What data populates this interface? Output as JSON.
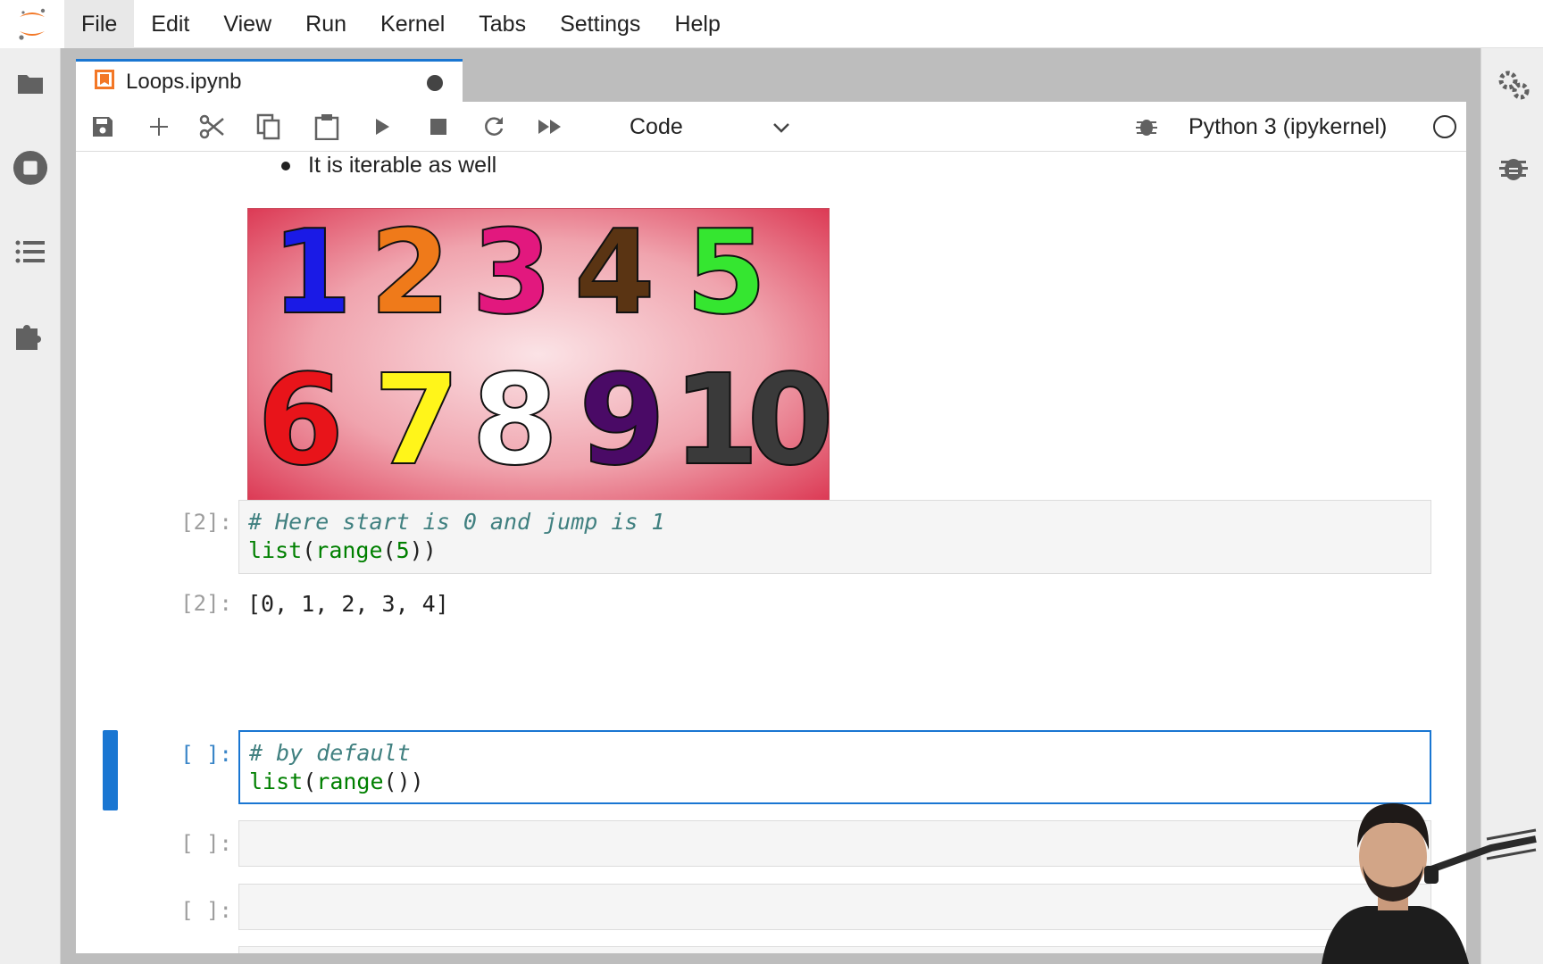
{
  "menubar": {
    "items": [
      "File",
      "Edit",
      "View",
      "Run",
      "Kernel",
      "Tabs",
      "Settings",
      "Help"
    ]
  },
  "tab": {
    "title": "Loops.ipynb"
  },
  "toolbar": {
    "cell_type": "Code",
    "kernel_name": "Python 3 (ipykernel)"
  },
  "notebook": {
    "markdown_bullet": "It is iterable as well",
    "image_digits": [
      "1",
      "2",
      "3",
      "4",
      "5",
      "6",
      "7",
      "8",
      "9",
      "10"
    ],
    "cells": [
      {
        "prompt": "[2]:",
        "code_comment": "# Here start is 0 and jump is 1",
        "code_builtin1": "list",
        "code_paren1": "(",
        "code_builtin2": "range",
        "code_paren2": "(",
        "code_num": "5",
        "code_close": "))",
        "output_prompt": "[2]:",
        "output": "[0, 1, 2, 3, 4]"
      },
      {
        "prompt": "[ ]:",
        "code_comment": "# by default",
        "code_builtin1": "list",
        "code_paren1": "(",
        "code_builtin2": "range",
        "code_close": "())"
      },
      {
        "prompt": "[ ]:"
      },
      {
        "prompt": "[ ]:"
      },
      {
        "prompt": "[ ]:"
      }
    ]
  },
  "colors": {
    "accent": "#1976d2",
    "jupyter_orange": "#f37726",
    "comment": "#408080",
    "builtin": "#008000"
  }
}
